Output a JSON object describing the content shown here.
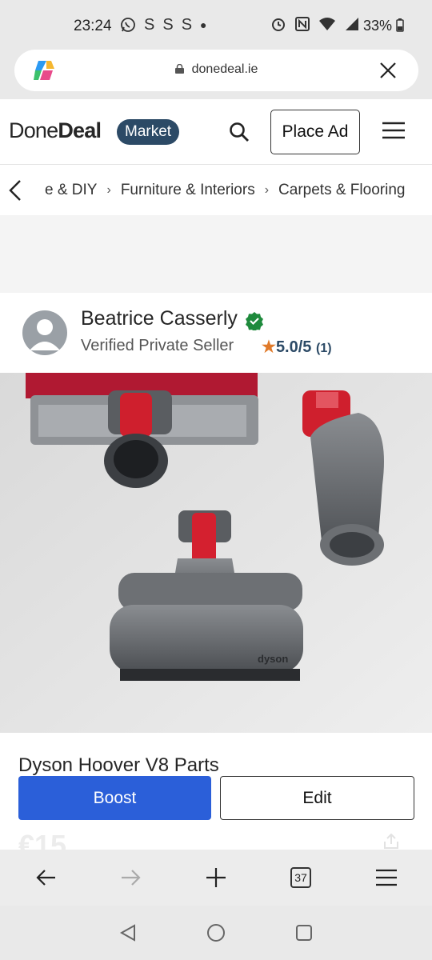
{
  "status_bar": {
    "time": "23:24",
    "left_icons": [
      "whatsapp-icon",
      "s-icon",
      "s-icon",
      "s-icon",
      "dot-icon"
    ],
    "right_icons": [
      "alarm-icon",
      "nfc-icon",
      "wifi-icon",
      "signal-icon"
    ],
    "battery": "33%"
  },
  "browser": {
    "url": "donedeal.ie",
    "tabs_count": "37"
  },
  "header": {
    "logo_done": "Done",
    "logo_deal": "Deal",
    "market_badge": "Market",
    "place_ad_label": "Place Ad"
  },
  "breadcrumb": {
    "items": [
      "e & DIY",
      "Furniture & Interiors",
      "Carpets & Flooring"
    ]
  },
  "seller": {
    "name": "Beatrice Casserly",
    "type": "Verified Private Seller",
    "rating": "5.0/5",
    "rating_count": "(1)"
  },
  "listing": {
    "title": "Dyson Hoover V8 Parts",
    "price": "€15"
  },
  "actions": {
    "boost_label": "Boost",
    "edit_label": "Edit"
  },
  "colors": {
    "brand_navy": "#2c4a66",
    "boost_blue": "#2b5fd9",
    "verified_green": "#1e8a3c",
    "star_orange": "#e07a2a"
  }
}
